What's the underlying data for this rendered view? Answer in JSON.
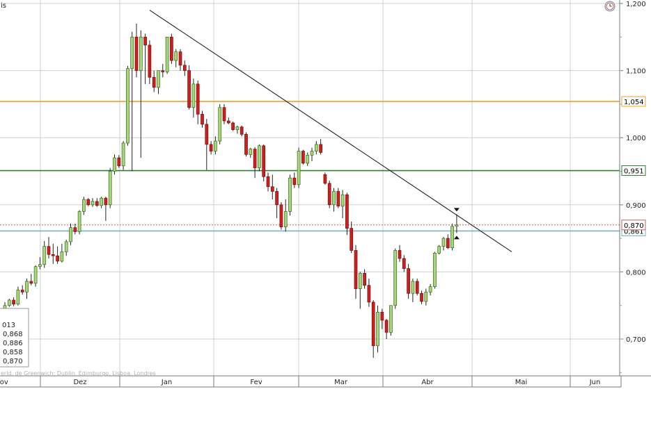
{
  "chart_data": {
    "type": "candlestick",
    "y_axis": {
      "min": 0.64,
      "max": 1.2,
      "ticks": [
        "1,200",
        "1,100",
        "1,000",
        "0,900",
        "0,800",
        "0,700"
      ],
      "side": "right",
      "grid": true
    },
    "x_axis": {
      "months": [
        "Nov",
        "Dez",
        "Jan",
        "Fev",
        "Mar",
        "Abr",
        "Mai",
        "Jun"
      ]
    },
    "top_left_label": "is",
    "horizontal_levels": [
      {
        "value": 1.054,
        "label": "1,054",
        "color": "#f0a030"
      },
      {
        "value": 0.951,
        "label": "0,951",
        "color": "#2e7d32"
      },
      {
        "value": 0.87,
        "label": "0,870",
        "color": "#c06060",
        "style": "dotted"
      },
      {
        "value": 0.861,
        "label": "0,861",
        "color": "#7ab0c8"
      }
    ],
    "trendline": {
      "start": {
        "date": "Jan 2",
        "value": 1.19
      },
      "end": {
        "date": "Mai 13",
        "value": 0.83
      }
    },
    "ohlc_panel": {
      "title": "013",
      "values": [
        "0,868",
        "0,886",
        "0,858",
        "0,870"
      ]
    },
    "timezone_note": "erid. de Greenwich: Dublin, Edimburgo, Lisboa, Londres",
    "colors": {
      "up": "#a6d87a",
      "down": "#cc1f1f",
      "grid": "#d0d0d0",
      "trend": "#222222",
      "up_border": "#3a6a20"
    },
    "candles": [
      [
        0.745,
        0.755,
        0.742,
        0.75
      ],
      [
        0.75,
        0.76,
        0.748,
        0.758
      ],
      [
        0.758,
        0.762,
        0.749,
        0.752
      ],
      [
        0.752,
        0.778,
        0.75,
        0.773
      ],
      [
        0.773,
        0.78,
        0.766,
        0.77
      ],
      [
        0.77,
        0.79,
        0.76,
        0.786
      ],
      [
        0.786,
        0.797,
        0.78,
        0.783
      ],
      [
        0.783,
        0.81,
        0.778,
        0.808
      ],
      [
        0.808,
        0.822,
        0.804,
        0.811
      ],
      [
        0.811,
        0.846,
        0.806,
        0.838
      ],
      [
        0.838,
        0.852,
        0.82,
        0.826
      ],
      [
        0.826,
        0.842,
        0.812,
        0.824
      ],
      [
        0.824,
        0.838,
        0.812,
        0.816
      ],
      [
        0.816,
        0.842,
        0.814,
        0.83
      ],
      [
        0.83,
        0.848,
        0.824,
        0.845
      ],
      [
        0.845,
        0.872,
        0.84,
        0.866
      ],
      [
        0.866,
        0.872,
        0.856,
        0.86
      ],
      [
        0.86,
        0.892,
        0.856,
        0.89
      ],
      [
        0.89,
        0.912,
        0.885,
        0.908
      ],
      [
        0.908,
        0.91,
        0.898,
        0.9
      ],
      [
        0.9,
        0.91,
        0.897,
        0.905
      ],
      [
        0.905,
        0.91,
        0.897,
        0.899
      ],
      [
        0.899,
        0.912,
        0.895,
        0.91
      ],
      [
        0.91,
        0.912,
        0.876,
        0.9
      ],
      [
        0.9,
        0.955,
        0.895,
        0.95
      ],
      [
        0.95,
        0.975,
        0.945,
        0.97
      ],
      [
        0.97,
        0.974,
        0.955,
        0.958
      ],
      [
        0.958,
        0.995,
        0.952,
        0.992
      ],
      [
        0.992,
        1.107,
        0.988,
        1.103
      ],
      [
        1.103,
        1.158,
        0.95,
        1.15
      ],
      [
        1.15,
        1.17,
        1.09,
        1.1
      ],
      [
        1.1,
        1.16,
        0.97,
        1.15
      ],
      [
        1.15,
        1.155,
        1.08,
        1.138
      ],
      [
        1.138,
        1.145,
        1.08,
        1.09
      ],
      [
        1.09,
        1.1,
        1.068,
        1.075
      ],
      [
        1.075,
        1.1,
        1.065,
        1.1
      ],
      [
        1.1,
        1.11,
        1.09,
        1.098
      ],
      [
        1.098,
        1.15,
        1.095,
        1.15
      ],
      [
        1.15,
        1.155,
        1.11,
        1.115
      ],
      [
        1.115,
        1.132,
        1.105,
        1.128
      ],
      [
        1.128,
        1.132,
        1.1,
        1.108
      ],
      [
        1.108,
        1.115,
        1.092,
        1.1
      ],
      [
        1.1,
        1.108,
        1.042,
        1.045
      ],
      [
        1.045,
        1.088,
        1.03,
        1.08
      ],
      [
        1.08,
        1.085,
        1.02,
        1.035
      ],
      [
        1.035,
        1.04,
        1.015,
        1.02
      ],
      [
        1.02,
        1.028,
        0.952,
        0.99
      ],
      [
        0.99,
        0.995,
        0.975,
        0.98
      ],
      [
        0.98,
        1.002,
        0.975,
        0.995
      ],
      [
        0.995,
        1.05,
        0.99,
        1.045
      ],
      [
        1.045,
        1.05,
        1.02,
        1.025
      ],
      [
        1.025,
        1.03,
        1.02,
        1.022
      ],
      [
        1.022,
        1.024,
        1.01,
        1.012
      ],
      [
        1.012,
        1.018,
        1.006,
        1.016
      ],
      [
        1.016,
        1.018,
        1.002,
        1.005
      ],
      [
        1.005,
        1.008,
        0.972,
        0.975
      ],
      [
        0.975,
        0.985,
        0.97,
        0.983
      ],
      [
        0.983,
        0.986,
        0.94,
        0.955
      ],
      [
        0.955,
        0.99,
        0.95,
        0.988
      ],
      [
        0.988,
        0.99,
        0.935,
        0.942
      ],
      [
        0.942,
        0.948,
        0.92,
        0.927
      ],
      [
        0.927,
        0.945,
        0.908,
        0.92
      ],
      [
        0.92,
        0.925,
        0.88,
        0.9
      ],
      [
        0.9,
        0.904,
        0.863,
        0.867
      ],
      [
        0.867,
        0.908,
        0.86,
        0.89
      ],
      [
        0.89,
        0.945,
        0.884,
        0.94
      ],
      [
        0.94,
        0.948,
        0.925,
        0.93
      ],
      [
        0.93,
        0.985,
        0.925,
        0.98
      ],
      [
        0.98,
        0.982,
        0.96,
        0.962
      ],
      [
        0.962,
        0.978,
        0.958,
        0.974
      ],
      [
        0.974,
        0.985,
        0.965,
        0.98
      ],
      [
        0.98,
        0.995,
        0.975,
        0.99
      ],
      [
        0.99,
        0.998,
        0.975,
        0.978
      ],
      [
        0.945,
        0.948,
        0.93,
        0.932
      ],
      [
        0.932,
        0.936,
        0.895,
        0.9
      ],
      [
        0.9,
        0.925,
        0.89,
        0.92
      ],
      [
        0.92,
        0.925,
        0.895,
        0.898
      ],
      [
        0.898,
        0.922,
        0.88,
        0.915
      ],
      [
        0.915,
        0.918,
        0.855,
        0.865
      ],
      [
        0.865,
        0.875,
        0.828,
        0.832
      ],
      [
        0.832,
        0.84,
        0.76,
        0.775
      ],
      [
        0.775,
        0.8,
        0.745,
        0.798
      ],
      [
        0.798,
        0.804,
        0.775,
        0.78
      ],
      [
        0.78,
        0.79,
        0.748,
        0.755
      ],
      [
        0.755,
        0.758,
        0.672,
        0.69
      ],
      [
        0.69,
        0.75,
        0.68,
        0.74
      ],
      [
        0.74,
        0.745,
        0.715,
        0.728
      ],
      [
        0.728,
        0.73,
        0.7,
        0.71
      ],
      [
        0.71,
        0.75,
        0.705,
        0.75
      ],
      [
        0.75,
        0.835,
        0.745,
        0.832
      ],
      [
        0.832,
        0.84,
        0.815,
        0.82
      ],
      [
        0.82,
        0.825,
        0.8,
        0.805
      ],
      [
        0.805,
        0.812,
        0.76,
        0.768
      ],
      [
        0.768,
        0.79,
        0.755,
        0.786
      ],
      [
        0.786,
        0.79,
        0.765,
        0.768
      ],
      [
        0.768,
        0.772,
        0.752,
        0.756
      ],
      [
        0.756,
        0.775,
        0.75,
        0.77
      ],
      [
        0.77,
        0.782,
        0.765,
        0.778
      ],
      [
        0.778,
        0.83,
        0.775,
        0.828
      ],
      [
        0.828,
        0.84,
        0.826,
        0.838
      ],
      [
        0.838,
        0.852,
        0.832,
        0.85
      ],
      [
        0.85,
        0.856,
        0.834,
        0.836
      ],
      [
        0.836,
        0.872,
        0.832,
        0.868
      ],
      [
        0.868,
        0.886,
        0.858,
        0.87
      ]
    ]
  }
}
